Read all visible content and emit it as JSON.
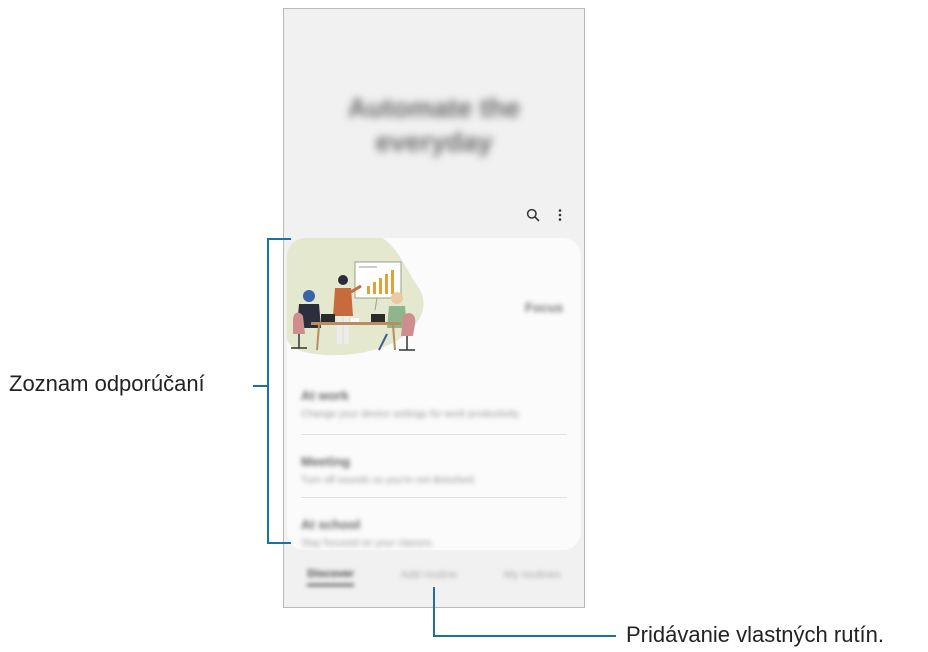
{
  "hero": {
    "line1": "Automate the",
    "line2": "everyday"
  },
  "toolbar": {
    "search_icon": "search-icon",
    "more_icon": "more-options-icon"
  },
  "card": {
    "action_label": "Focus"
  },
  "recommendations": [
    {
      "title": "At work",
      "description": "Change your device settings for work productivity."
    },
    {
      "title": "Meeting",
      "description": "Turn off sounds so you're not disturbed."
    },
    {
      "title": "At school",
      "description": "Stay focused on your classes."
    }
  ],
  "tabs": [
    {
      "label": "Discover",
      "active": true
    },
    {
      "label": "Add routine",
      "active": false
    },
    {
      "label": "My routines",
      "active": false
    }
  ],
  "annotations": {
    "recommendation_list": "Zoznam odporúčaní",
    "add_custom_routines": "Pridávanie vlastných rutín."
  },
  "colors": {
    "callout": "#1e6fa8",
    "illustration_blob": "#e3e8cf"
  }
}
